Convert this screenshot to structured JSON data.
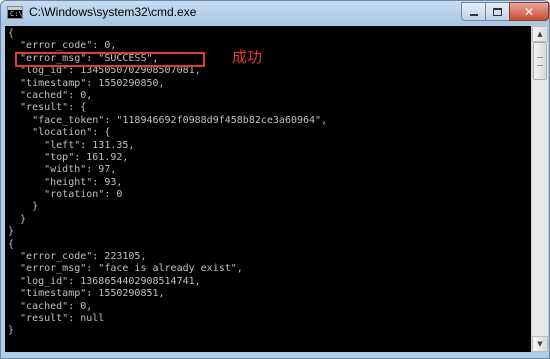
{
  "window": {
    "title": "C:\\Windows\\system32\\cmd.exe",
    "icon": "console-icon",
    "icon_text": "C:\\"
  },
  "controls": {
    "minimize_icon": "minimize-icon",
    "maximize_icon": "maximize-icon",
    "close_icon": "close-icon",
    "close_glyph": "✕"
  },
  "console": {
    "lines": [
      "{",
      "  \"error_code\": 0,",
      "  \"error_msg\": \"SUCCESS\",",
      "  \"log_id\": 1345050702908507081,",
      "  \"timestamp\": 1550290850,",
      "  \"cached\": 0,",
      "  \"result\": {",
      "    \"face_token\": \"118946692f0988d9f458b82ce3a60964\",",
      "    \"location\": {",
      "      \"left\": 131.35,",
      "      \"top\": 161.92,",
      "      \"width\": 97,",
      "      \"height\": 93,",
      "      \"rotation\": 0",
      "    }",
      "  }",
      "}",
      "{",
      "  \"error_code\": 223105,",
      "  \"error_msg\": \"face is already exist\",",
      "  \"log_id\": 1368654402908514741,",
      "  \"timestamp\": 1550290851,",
      "  \"cached\": 0,",
      "  \"result\": null",
      "}"
    ]
  },
  "annotation": {
    "label": "成功",
    "color": "#e03a3a"
  },
  "scrollbar": {
    "up_glyph": "▲",
    "down_glyph": "▼"
  }
}
